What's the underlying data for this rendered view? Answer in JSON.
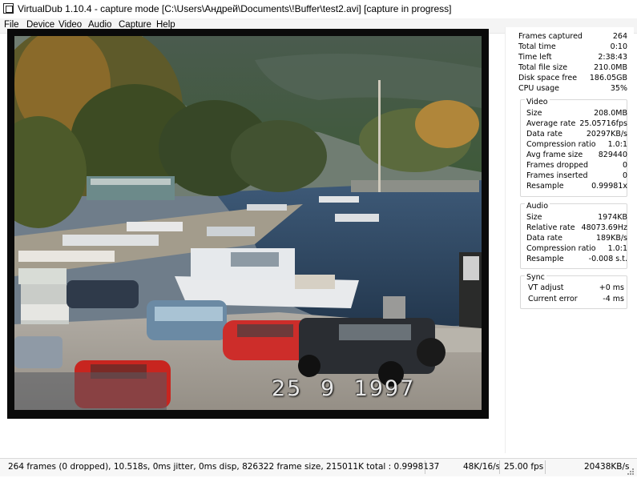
{
  "window": {
    "title": "VirtualDub 1.10.4 - capture mode [C:\\Users\\Андрей\\Documents\\!Buffer\\test2.avi] [capture in progress]"
  },
  "menu": [
    "File",
    "Device",
    "Video",
    "Audio",
    "Capture",
    "Help"
  ],
  "overlay": {
    "date_stamp": "25 9 1997"
  },
  "stats": {
    "top": [
      {
        "label": "Frames captured",
        "value": "264"
      },
      {
        "label": "Total time",
        "value": "0:10"
      },
      {
        "label": "Time left",
        "value": "2:38:43"
      },
      {
        "label": "Total file size",
        "value": "210.0MB"
      },
      {
        "label": "Disk space free",
        "value": "186.05GB"
      },
      {
        "label": "CPU usage",
        "value": "35%"
      }
    ],
    "video": {
      "title": "Video",
      "rows": [
        {
          "label": "Size",
          "value": "208.0MB"
        },
        {
          "label": "Average rate",
          "value": "25.05716fps"
        },
        {
          "label": "Data rate",
          "value": "20297KB/s"
        },
        {
          "label": "Compression ratio",
          "value": "1.0:1"
        },
        {
          "label": "Avg frame size",
          "value": "829440"
        },
        {
          "label": "Frames dropped",
          "value": "0"
        },
        {
          "label": "Frames inserted",
          "value": "0"
        },
        {
          "label": "Resample",
          "value": "0.99981x"
        }
      ]
    },
    "audio": {
      "title": "Audio",
      "rows": [
        {
          "label": "Size",
          "value": "1974KB"
        },
        {
          "label": "Relative rate",
          "value": "48073.69Hz"
        },
        {
          "label": "Data rate",
          "value": "189KB/s"
        },
        {
          "label": "Compression ratio",
          "value": "1.0:1"
        },
        {
          "label": "Resample",
          "value": "-0.008 s.t."
        }
      ]
    },
    "sync": {
      "title": "Sync",
      "rows": [
        {
          "label": "VT adjust",
          "value": "+0 ms"
        },
        {
          "label": "Current error",
          "value": "-4 ms"
        }
      ]
    }
  },
  "status": {
    "main": "264 frames (0 dropped), 10.518s, 0ms jitter, 0ms disp, 826322 frame size, 215011K total : 0.9998137",
    "audio_rate": "48K/16/s",
    "fps": "25.00 fps",
    "data_rate": "20438KB/s"
  }
}
